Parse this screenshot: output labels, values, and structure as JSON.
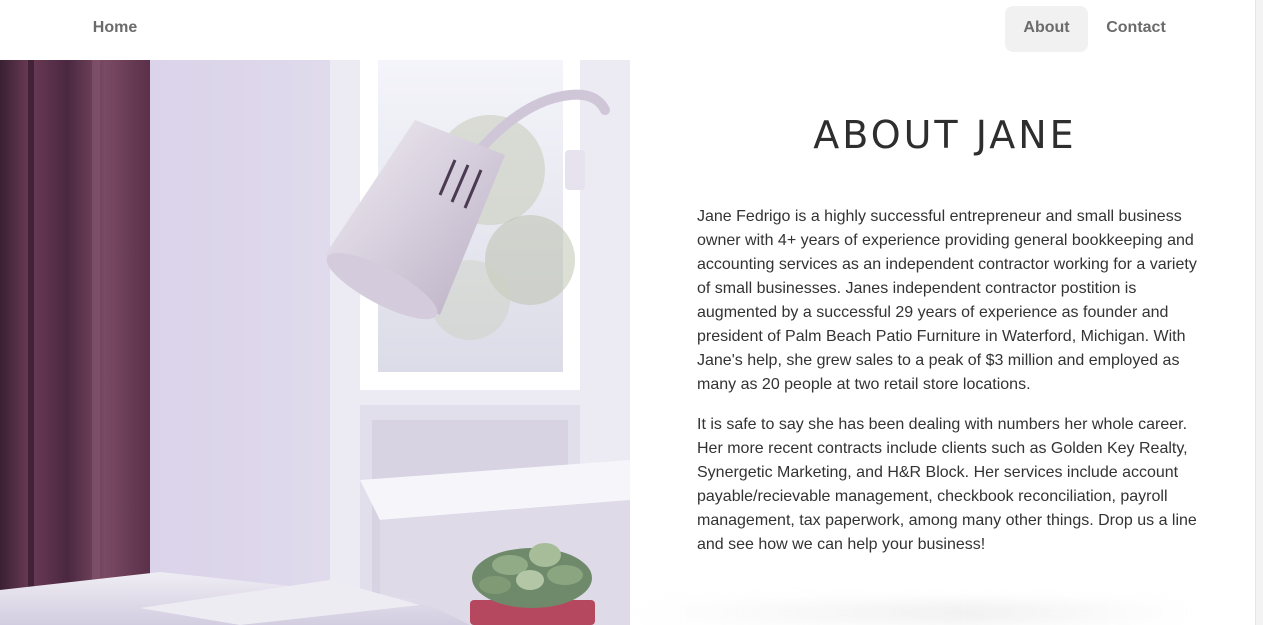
{
  "nav": {
    "home_label": "Home",
    "about_label": "About",
    "contact_label": "Contact",
    "active": "About"
  },
  "about": {
    "title": "ABOUT JANE",
    "paragraph_1": "Jane Fedrigo is a highly successful entrepreneur and small business owner with 4+ years of experience providing general bookkeeping and accounting services as an independent contractor working for a variety of small businesses. Janes independent contractor postition is augmented by a successful 29 years of experience as founder and president of Palm Beach Patio Furniture in Waterford, Michigan. With Jane's help, she grew sales to a peak of $3 million and employed as many as 20 people at two retail store locations.",
    "paragraph_2": "It is safe to say she has been dealing with numbers her whole career. Her more recent contracts include clients such as Golden Key Realty, Synergetic Marketing, and H&R Block. Her services include account payable/recievable management, checkbook reconciliation, payroll management, tax paperwork, among many other things. Drop us a line and see how we can help your business!"
  },
  "colors": {
    "nav_text": "#6b6b6b",
    "nav_active_bg": "#f1f1f1",
    "title_text": "#2e2e2e",
    "body_text": "#333333"
  },
  "photo": {
    "icon": "desk-lamp-photo"
  }
}
